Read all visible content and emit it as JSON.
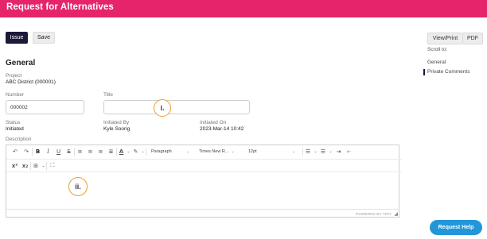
{
  "header": {
    "title": "Request for Alternatives"
  },
  "toolbar": {
    "issue_label": "Issue",
    "save_label": "Save"
  },
  "export": {
    "view_print_label": "View/Print",
    "pdf_label": "PDF"
  },
  "scroll_to": {
    "label": "Scroll to:",
    "items": [
      "General",
      "Private Comments"
    ]
  },
  "general": {
    "section_title": "General",
    "project_label": "Project",
    "project_value": "ABC District (000001)",
    "number_label": "Number",
    "number_value": "000002",
    "title_label": "Title",
    "title_value": "",
    "status_label": "Status",
    "status_value": "Initiated",
    "initiated_by_label": "Initiated By",
    "initiated_by_value": "Kyle Soong",
    "initiated_on_label": "Initiated On",
    "initiated_on_value": "2023-Mar-14 10:42",
    "description_label": "Description"
  },
  "editor": {
    "paragraph_format": "Paragraph",
    "font_family": "Times New R...",
    "font_size": "12pt",
    "powered_by": "POWERED BY TINY"
  },
  "callouts": {
    "title_marker": "i.",
    "description_marker": "ii."
  },
  "help": {
    "label": "Request Help"
  },
  "colors": {
    "header": "#e6246b",
    "primary_button": "#1b1a3a",
    "help_button": "#2196d9",
    "callout_ring": "#e7a22c"
  }
}
